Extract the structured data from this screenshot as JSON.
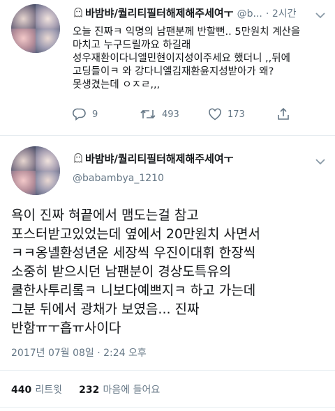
{
  "tweet1": {
    "display_name": "바밤뱌/퀄리티필터해제해주세여ㅜ",
    "handle": "@b...",
    "time": "· 2시간",
    "text": "오늘 진짜ㅋ 익명의 남팬분께 반할뻔.. 5만원치 계산을\n마치고 누구드릴까요 하길래\n성우재환이다니엘민현이지성이주세요 했더니 ,,뒤에\n고딩들이ㅋ 와 강다니엘김재환윤지성받아가 왜?\n못생겼는데 ㅇㅈㄹ,,,",
    "actions": {
      "reply_count": "9",
      "retweet_count": "493",
      "like_count": "173"
    }
  },
  "tweet2": {
    "display_name": "바밤뱌/퀄리티필터해제해주세여ㅜ",
    "handle": "@babambya_1210",
    "text": "욕이 진짜 혀끝에서 맴도는걸 참고\n포스터받고있었는데 옆에서 20만원치 사면서\nㅋㅋ옹녤환성년운 세장씩 우진이대휘 한장씩\n소중히 받으시던 남팬분이 경상도특유의\n쿨한사투리롴ㅋ 니보다예쁘지ㅋ 하고 가는데\n그분 뒤에서 광채가 보였음... 진짜\n반함ㅠㅜ흡ㅠ사이다",
    "timestamp": "2017년 07월 08일 · 2:24 오후"
  },
  "stats": {
    "retweets_count": "440",
    "retweets_label": "리트윗",
    "likes_count": "232",
    "likes_label": "마음에 들어요"
  },
  "colors": {
    "text": "#14171a",
    "secondary": "#657786",
    "divider": "#e6ecf0"
  }
}
